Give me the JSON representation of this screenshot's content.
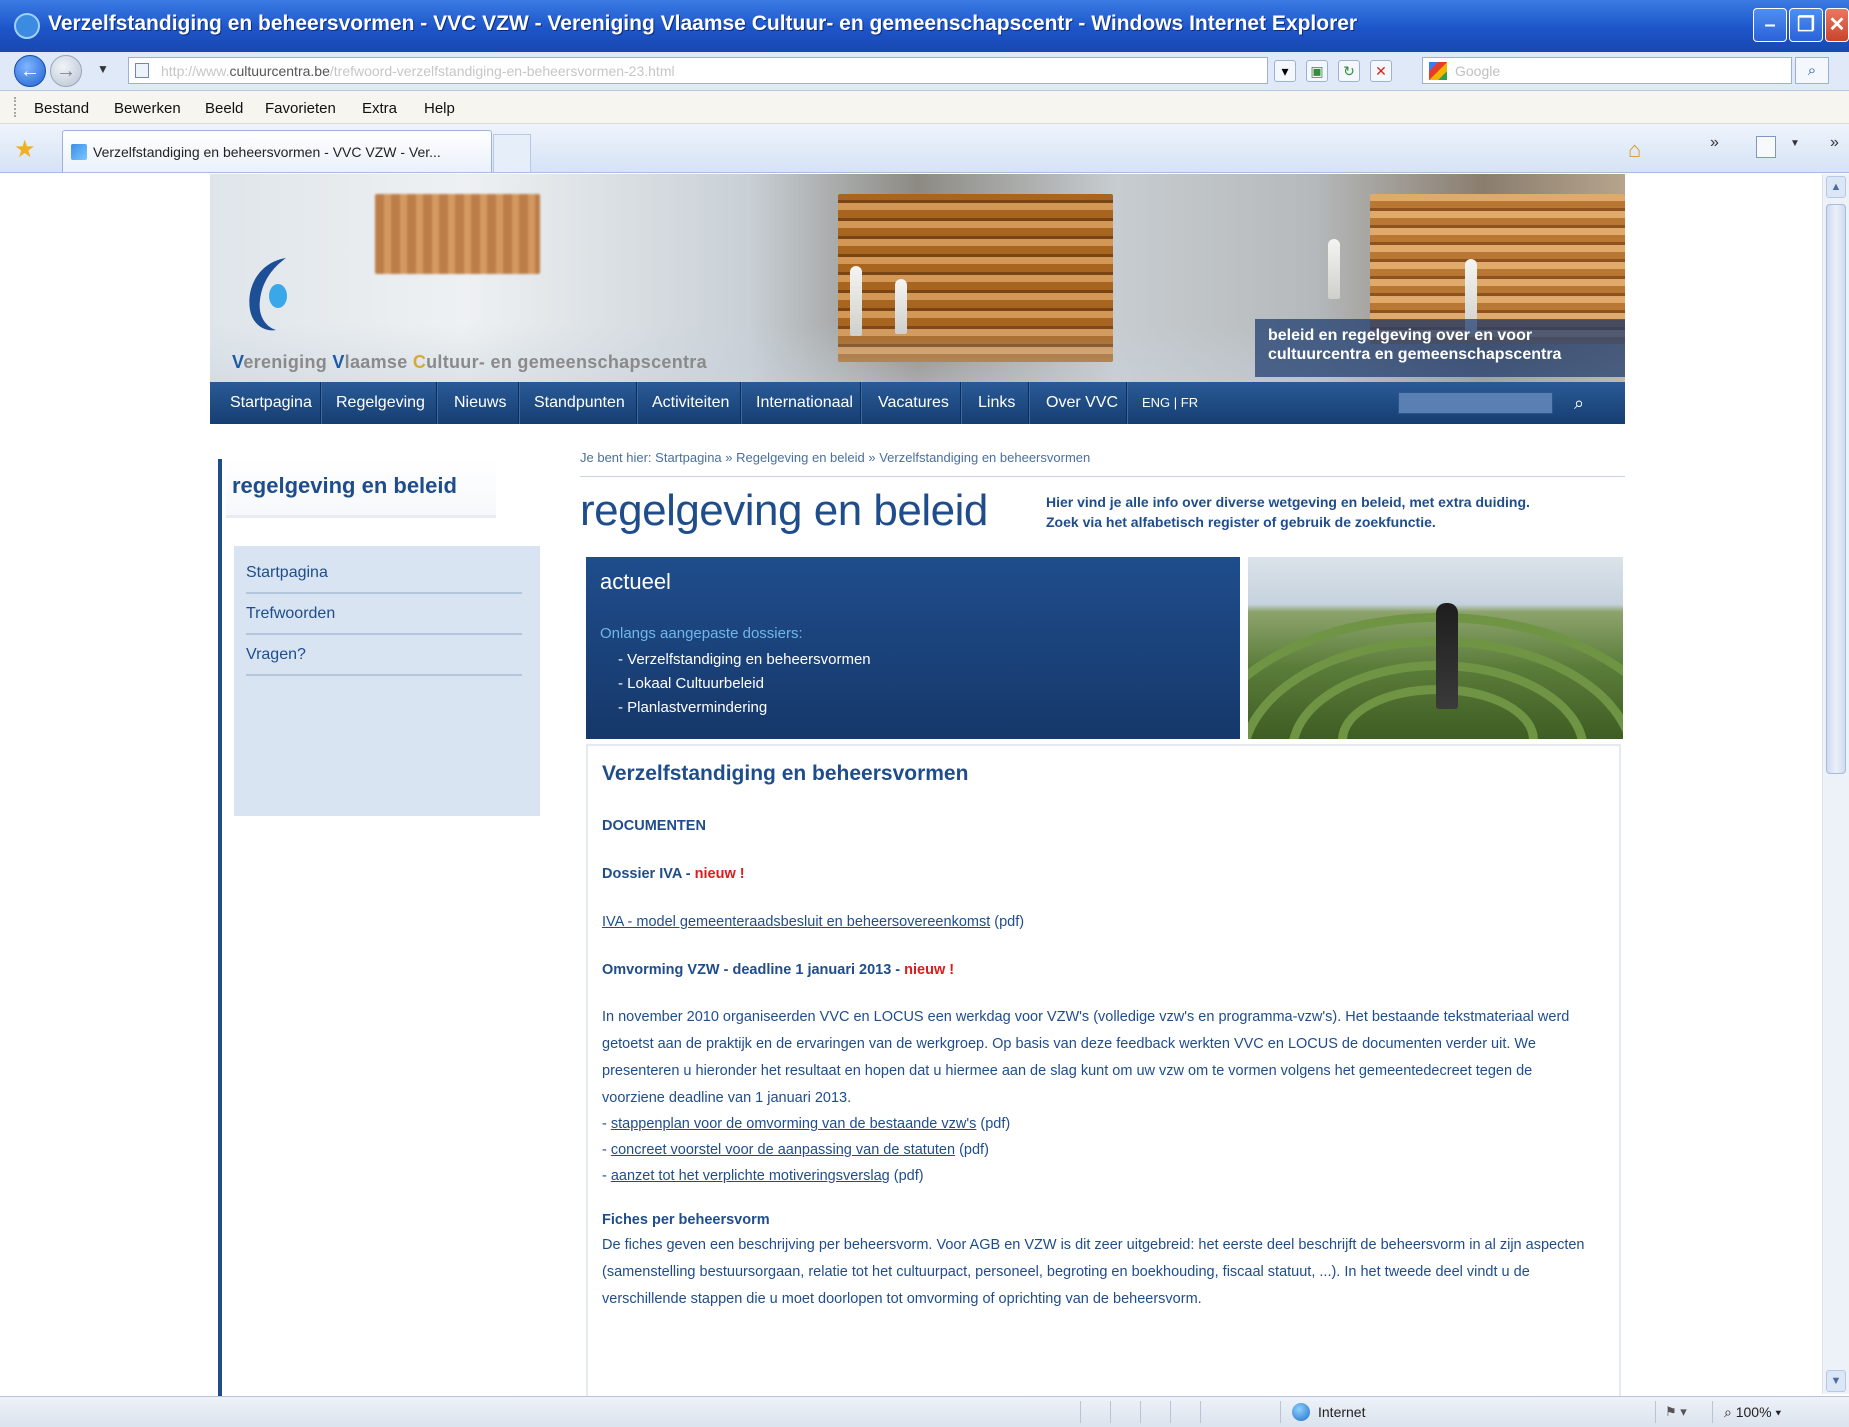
{
  "window": {
    "title": "Verzelfstandiging en beheersvormen - VVC VZW - Vereniging Vlaamse Cultuur- en gemeenschapscentr - Windows Internet Explorer"
  },
  "address": {
    "url_prefix": "http://www.",
    "url_domain": "cultuurcentra.be",
    "url_path": "/trefwoord-verzelfstandiging-en-beheersvormen-23.html",
    "search_placeholder": "Google"
  },
  "menu": [
    "Bestand",
    "Bewerken",
    "Beeld",
    "Favorieten",
    "Extra",
    "Help"
  ],
  "tab": {
    "label": "Verzelfstandiging en beheersvormen - VVC VZW - Ver..."
  },
  "statusbar": {
    "zone": "Internet",
    "zoom": "100%"
  },
  "site": {
    "org_parts": [
      "V",
      "ereniging ",
      "V",
      "laamse ",
      "C",
      "ultuur- en gemeenschapscentra"
    ],
    "banner_caption_1": "beleid en regelgeving over en voor",
    "banner_caption_2": "cultuurcentra en gemeenschapscentra",
    "nav": [
      "Startpagina",
      "Regelgeving",
      "Nieuws",
      "Standpunten",
      "Activiteiten",
      "Internationaal",
      "Vacatures",
      "Links",
      "Over VVC",
      "ENG | FR"
    ]
  },
  "sidebar": {
    "title": "regelgeving en beleid",
    "items": [
      "Startpagina",
      "Trefwoorden",
      "Vragen?"
    ]
  },
  "main": {
    "breadcrumb": "Je bent hier: Startpagina » Regelgeving en beleid » Verzelfstandiging en beheersvormen",
    "title": "regelgeving en beleid",
    "intro_1": "Hier vind je alle info over diverse wetgeving en beleid, met extra duiding.",
    "intro_2": "Zoek via het alfabetisch register of gebruik de zoekfunctie."
  },
  "actueel": {
    "heading": "actueel",
    "subheading": "Onlangs aangepaste dossiers:",
    "items": [
      "- Verzelfstandiging en beheersvormen",
      "- Lokaal Cultuurbeleid",
      "- Planlastvermindering"
    ]
  },
  "article": {
    "title": "Verzelfstandiging en beheersvormen",
    "documenten": "DOCUMENTEN",
    "dossier_iva": "Dossier IVA - ",
    "nieuw": "nieuw !",
    "iva_link": "IVA - model gemeenteraadsbesluit en beheersovereenkomst",
    "pdf": "(pdf)",
    "omvorming": "Omvorming VZW - deadline 1 januari 2013",
    "omvorming_sep": " - ",
    "para1": "In november 2010 organiseerden VVC en LOCUS een werkdag voor VZW's (volledige vzw's en programma-vzw's). Het bestaande tekstmateriaal werd getoetst aan de praktijk en de ervaringen van de werkgroep. Op basis van deze feedback werkten VVC en LOCUS de documenten verder uit. We presenteren u hieronder het resultaat en hopen dat u hiermee aan de slag kunt om uw vzw om te vormen volgens het gemeentedecreet tegen de voorziene deadline van 1 januari 2013.",
    "links": [
      {
        "text": "stappenplan voor de omvorming van de bestaande vzw's",
        "suffix": "(pdf)"
      },
      {
        "text": "concreet voorstel voor de aanpassing van de statuten",
        "suffix": "(pdf)"
      },
      {
        "text": "aanzet tot het verplichte motiveringsverslag",
        "suffix": "(pdf)"
      }
    ],
    "fiches_title": "Fiches per beheersvorm",
    "para2": "De fiches geven een beschrijving per beheersvorm. Voor AGB en VZW is dit zeer uitgebreid: het eerste deel beschrijft de beheersvorm in al zijn aspecten (samenstelling bestuursorgaan, relatie tot het cultuurpact, personeel, begroting en boekhouding, fiscaal statuut, ...). In het tweede deel vindt u de verschillende stappen die u moet doorlopen tot omvorming of oprichting van de beheersvorm."
  }
}
